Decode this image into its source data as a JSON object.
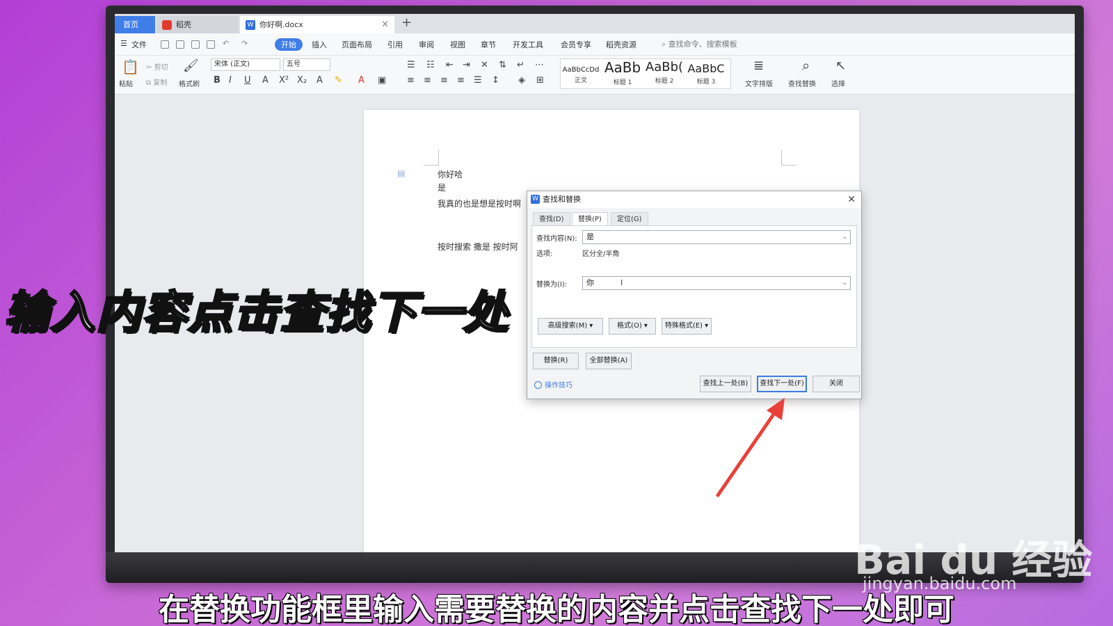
{
  "tabs": {
    "home": "首页",
    "daoke": "稻壳",
    "document": "你好啊.docx"
  },
  "menu": {
    "file": "文件",
    "items": [
      "开始",
      "插入",
      "页面布局",
      "引用",
      "审阅",
      "视图",
      "章节",
      "开发工具",
      "会员专享",
      "稻壳资源"
    ],
    "search_placeholder": "查找命令、搜索模板"
  },
  "ribbon": {
    "paste": "粘贴",
    "cut": "剪切",
    "copy": "复制",
    "format_painter": "格式刷",
    "font_name": "宋体 (正文)",
    "font_size": "五号",
    "styles": [
      {
        "sample": "AaBbCcDd",
        "label": "正文"
      },
      {
        "sample": "AaBb",
        "label": "标题 1"
      },
      {
        "sample": "AaBb(",
        "label": "标题 2"
      },
      {
        "sample": "AaBbC",
        "label": "标题 3"
      }
    ],
    "text_layout": "文字排版",
    "find_replace": "查找替换",
    "select": "选择"
  },
  "document": {
    "lines": [
      "你好哈",
      "是",
      "我真的也是想是按时啊",
      "按时搜索  撒是  按时阿"
    ]
  },
  "dialog": {
    "title": "查找和替换",
    "tabs": [
      "查找(D)",
      "替换(P)",
      "定位(G)"
    ],
    "find_label": "查找内容(N):",
    "find_value": "是",
    "options_label": "选项:",
    "options_value": "区分全/半角",
    "replace_label": "替换为(I):",
    "replace_value": "你",
    "advanced_search": "高级搜索(M)",
    "format": "格式(O)",
    "special_format": "特殊格式(E)",
    "replace_btn": "替换(R)",
    "replace_all_btn": "全部替换(A)",
    "tips": "操作技巧",
    "find_prev": "查找上一处(B)",
    "find_next": "查找下一处(F)",
    "close": "关闭"
  },
  "overlay": {
    "title": "输入内容点击查找下一处",
    "subtitle": "在替换功能框里输入需要替换的内容并点击查找下一处即可"
  },
  "watermark": {
    "brand": "Bai du 经验",
    "url": "jingyan.baidu.com"
  },
  "colors": {
    "accent": "#3f7ee8",
    "arrow": "#e8413a",
    "background": "#c766d6"
  }
}
